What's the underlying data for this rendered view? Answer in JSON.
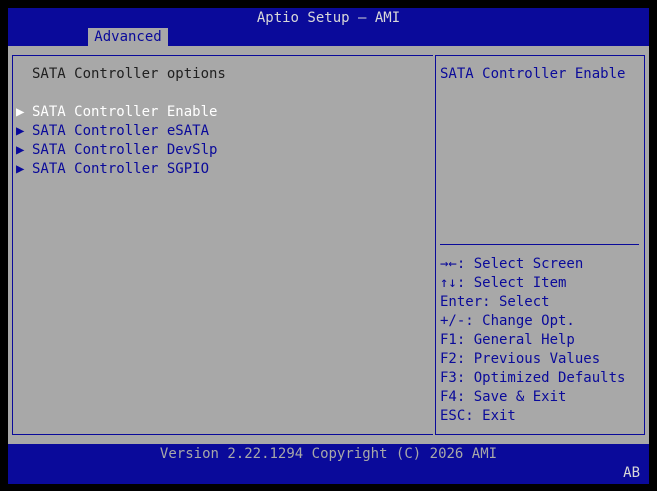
{
  "header": {
    "title": "Aptio Setup – AMI",
    "tabs": [
      {
        "label": "Advanced"
      }
    ]
  },
  "main": {
    "title": "SATA Controller options",
    "items": [
      {
        "label": "SATA Controller Enable",
        "arrow": "▶"
      },
      {
        "label": "SATA Controller eSATA",
        "arrow": "▶"
      },
      {
        "label": "SATA Controller DevSlp",
        "arrow": "▶"
      },
      {
        "label": "SATA Controller SGPIO",
        "arrow": "▶"
      }
    ]
  },
  "help": {
    "description": "SATA Controller Enable",
    "keys": [
      "→←: Select Screen",
      "↑↓: Select Item",
      "Enter: Select",
      "+/-: Change Opt.",
      "F1: General Help",
      "F2: Previous Values",
      "F3: Optimized Defaults",
      "F4: Save & Exit",
      "ESC: Exit"
    ]
  },
  "footer": {
    "version": "Version 2.22.1294 Copyright (C) 2026 AMI",
    "indicator": "AB"
  },
  "colors": {
    "bios_blue": "#0a0a9a",
    "bios_gray": "#a8a8a8",
    "highlight_white": "#ffffff"
  }
}
